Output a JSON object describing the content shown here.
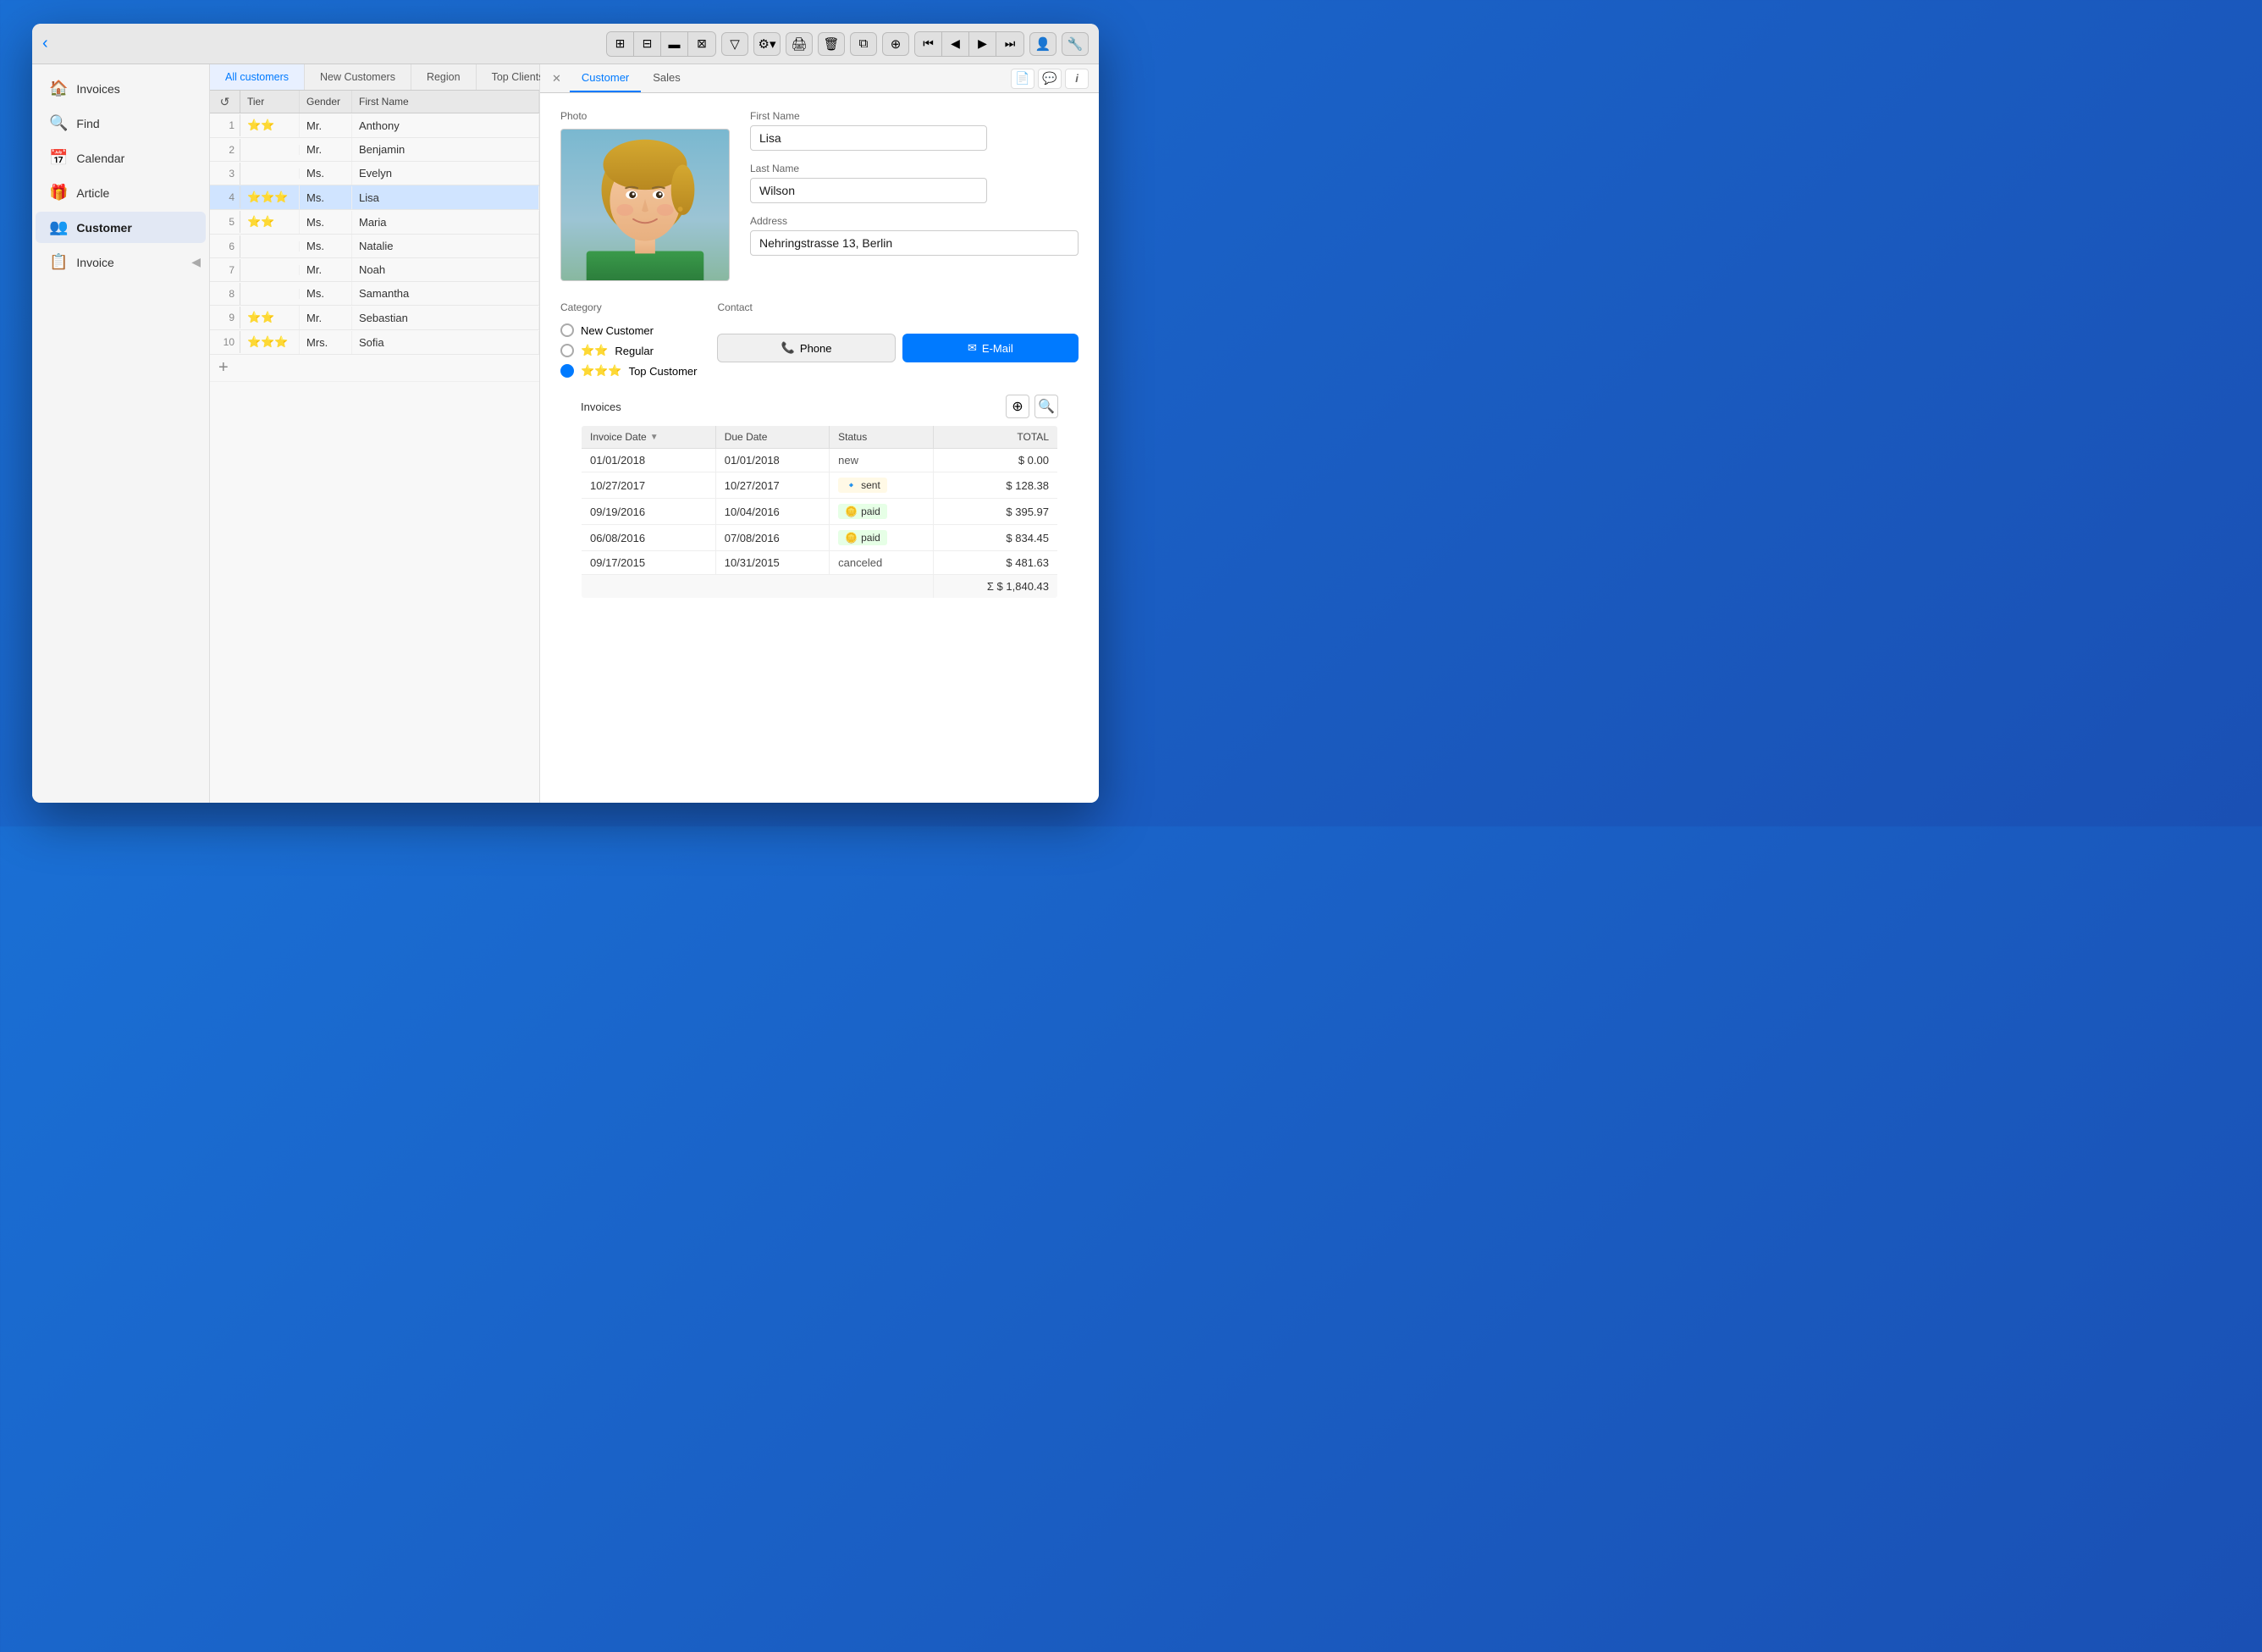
{
  "toolbar": {
    "back_icon": "◀",
    "view_icons": [
      "⊞",
      "⊟",
      "⬛",
      "⊠"
    ],
    "filter_icon": "▽",
    "gear_icon": "⚙",
    "print_icon": "🖨",
    "trash_icon": "🗑",
    "copy_icon": "⧉",
    "add_icon": "⊕",
    "nav_icons": [
      "⏮",
      "◀",
      "▶",
      "⏭"
    ],
    "user_icon": "👤",
    "wrench_icon": "🔧"
  },
  "sidebar": {
    "items": [
      {
        "id": "invoices",
        "icon": "🏠",
        "label": "Invoices",
        "active": false
      },
      {
        "id": "find",
        "icon": "🔍",
        "label": "Find",
        "active": false
      },
      {
        "id": "calendar",
        "icon": "📅",
        "label": "Calendar",
        "active": false
      },
      {
        "id": "article",
        "icon": "🎁",
        "label": "Article",
        "active": false
      },
      {
        "id": "customer",
        "icon": "👥",
        "label": "Customer",
        "active": true
      },
      {
        "id": "invoice",
        "icon": "📋",
        "label": "Invoice",
        "active": false
      }
    ]
  },
  "tabs": [
    {
      "id": "all-customers",
      "label": "All customers",
      "active": true
    },
    {
      "id": "new-customers",
      "label": "New Customers",
      "active": false
    },
    {
      "id": "region",
      "label": "Region",
      "active": false
    },
    {
      "id": "top-clients",
      "label": "Top Clients",
      "active": false
    }
  ],
  "table": {
    "columns": {
      "tier": "Tier",
      "gender": "Gender",
      "first_name": "First Name"
    },
    "rows": [
      {
        "num": 1,
        "tier": "⭐⭐",
        "gender": "Mr.",
        "first_name": "Anthony",
        "selected": false
      },
      {
        "num": 2,
        "tier": "",
        "gender": "Mr.",
        "first_name": "Benjamin",
        "selected": false
      },
      {
        "num": 3,
        "tier": "",
        "gender": "Ms.",
        "first_name": "Evelyn",
        "selected": false
      },
      {
        "num": 4,
        "tier": "⭐⭐⭐",
        "gender": "Ms.",
        "first_name": "Lisa",
        "selected": true
      },
      {
        "num": 5,
        "tier": "⭐⭐",
        "gender": "Ms.",
        "first_name": "Maria",
        "selected": false
      },
      {
        "num": 6,
        "tier": "",
        "gender": "Ms.",
        "first_name": "Natalie",
        "selected": false
      },
      {
        "num": 7,
        "tier": "",
        "gender": "Mr.",
        "first_name": "Noah",
        "selected": false
      },
      {
        "num": 8,
        "tier": "",
        "gender": "Ms.",
        "first_name": "Samantha",
        "selected": false
      },
      {
        "num": 9,
        "tier": "⭐⭐",
        "gender": "Mr.",
        "first_name": "Sebastian",
        "selected": false
      },
      {
        "num": 10,
        "tier": "⭐⭐⭐",
        "gender": "Mrs.",
        "first_name": "Sofia",
        "selected": false
      }
    ]
  },
  "detail_tabs": [
    {
      "id": "customer",
      "label": "Customer",
      "active": true
    },
    {
      "id": "sales",
      "label": "Sales",
      "active": false
    },
    {
      "id": "doc",
      "label": "📄",
      "active": false
    },
    {
      "id": "chat",
      "label": "💬",
      "active": false
    },
    {
      "id": "info",
      "label": "i",
      "active": false
    }
  ],
  "customer": {
    "photo_label": "Photo",
    "first_name_label": "First Name",
    "first_name": "Lisa",
    "last_name_label": "Last Name",
    "last_name": "Wilson",
    "address_label": "Address",
    "address": "Nehringstrasse 13, Berlin",
    "category_label": "Category",
    "categories": [
      {
        "id": "new",
        "label": "New Customer",
        "selected": false
      },
      {
        "id": "regular",
        "label": "Regular",
        "stars": "⭐⭐",
        "selected": false
      },
      {
        "id": "top",
        "label": "Top Customer",
        "stars": "⭐⭐⭐",
        "selected": true
      }
    ],
    "contact_label": "Contact",
    "phone_btn": "Phone",
    "email_btn": "E-Mail"
  },
  "invoices": {
    "section_label": "Invoices",
    "add_icon": "⊕",
    "search_icon": "🔍",
    "columns": {
      "invoice_date": "Invoice Date",
      "due_date": "Due Date",
      "status": "Status",
      "total": "TOTAL"
    },
    "rows": [
      {
        "invoice_date": "01/01/2018",
        "due_date": "01/01/2018",
        "status": "new",
        "status_type": "new",
        "total": "$ 0.00"
      },
      {
        "invoice_date": "10/27/2017",
        "due_date": "10/27/2017",
        "status": "sent",
        "status_type": "sent",
        "total": "$ 128.38"
      },
      {
        "invoice_date": "09/19/2016",
        "due_date": "10/04/2016",
        "status": "paid",
        "status_type": "paid",
        "total": "$ 395.97"
      },
      {
        "invoice_date": "06/08/2016",
        "due_date": "07/08/2016",
        "status": "paid",
        "status_type": "paid",
        "total": "$ 834.45"
      },
      {
        "invoice_date": "09/17/2015",
        "due_date": "10/31/2015",
        "status": "canceled",
        "status_type": "canceled",
        "total": "$ 481.63"
      }
    ],
    "total_sum": "Σ $ 1,840.43"
  }
}
